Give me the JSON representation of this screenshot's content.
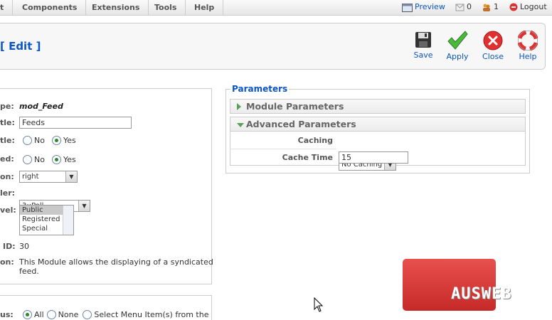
{
  "menubar": {
    "items": [
      "t",
      "Components",
      "Extensions",
      "Tools",
      "Help"
    ],
    "preview": "Preview",
    "messages_count": "0",
    "users_count": "1",
    "logout": "Logout"
  },
  "toolbar": {
    "title": "[ Edit ]",
    "save": "Save",
    "apply": "Apply",
    "close": "Close",
    "help": "Help"
  },
  "details": {
    "labels": {
      "type": "pe:",
      "title": "tle:",
      "show_title": "tle:",
      "enabled": "ed:",
      "position": "on:",
      "order": "ler:",
      "access": "vel:",
      "id": "ID:",
      "description": "on:"
    },
    "type_value": "mod_Feed",
    "title_value": "Feeds",
    "show_title": {
      "no": "No",
      "yes": "Yes",
      "selected": "Yes"
    },
    "enabled": {
      "no": "No",
      "yes": "Yes",
      "selected": "Yes"
    },
    "position_value": "right",
    "order_value": "3::Poll",
    "access_options": [
      "Public",
      "Registered",
      "Special"
    ],
    "access_selected": "Public",
    "id_value": "30",
    "description_line1": "This Module allows the displaying of a syndicated",
    "description_line2": "feed."
  },
  "menus": {
    "label": "us:",
    "all": "All",
    "none": "None",
    "select": "Select Menu Item(s) from the",
    "selected": "All"
  },
  "parameters": {
    "legend": "Parameters",
    "module_params": "Module Parameters",
    "advanced_params": "Advanced Parameters",
    "caching_label": "Caching",
    "caching_value": "No Caching",
    "cache_time_label": "Cache Time",
    "cache_time_value": "15"
  },
  "watermark": {
    "text": "AUSWEB"
  },
  "colors": {
    "link_blue": "#0b55c4",
    "accent_green": "#5aa05a",
    "watermark_red": "#d63b38"
  }
}
